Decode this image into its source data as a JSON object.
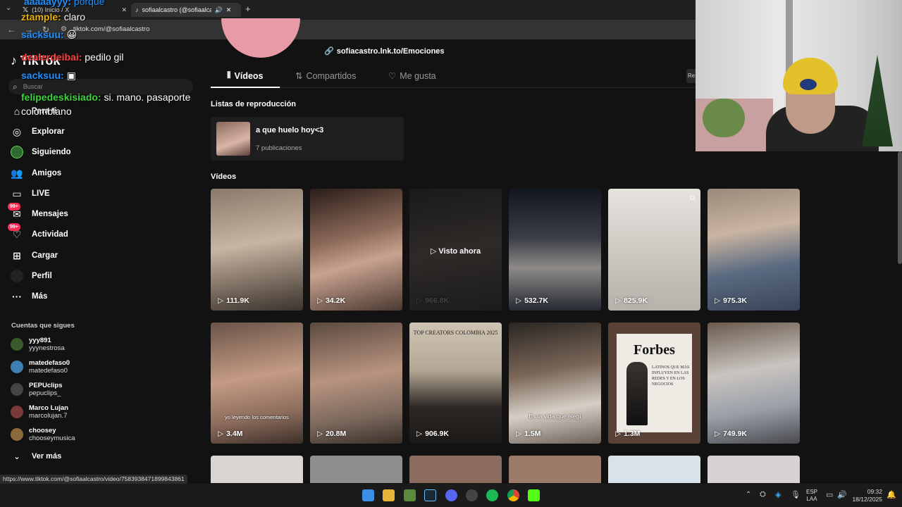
{
  "browser": {
    "tabs": [
      {
        "title": "(10) Inicio / X"
      },
      {
        "title": "sofiaalcastro (@sofiaalcastro"
      }
    ],
    "url": "tiktok.com/@sofiaalcastro",
    "status_url": "https://www.tiktok.com/@sofiaalcastro/video/7583938471899843861"
  },
  "sidebar": {
    "search_placeholder": "Buscar",
    "items": [
      {
        "label": "Para ti",
        "icon": "home-icon"
      },
      {
        "label": "Explorar",
        "icon": "compass-icon"
      },
      {
        "label": "Siguiendo",
        "icon": "following-icon"
      },
      {
        "label": "Amigos",
        "icon": "friends-icon"
      },
      {
        "label": "LIVE",
        "icon": "live-icon"
      },
      {
        "label": "Mensajes",
        "icon": "messages-icon",
        "badge": "99+"
      },
      {
        "label": "Actividad",
        "icon": "activity-icon",
        "badge": "99+"
      },
      {
        "label": "Cargar",
        "icon": "upload-icon"
      },
      {
        "label": "Perfil",
        "icon": "profile-icon"
      },
      {
        "label": "Más",
        "icon": "more-icon"
      }
    ],
    "following_title": "Cuentas que sigues",
    "following": [
      {
        "name": "yyy891",
        "handle": "yyynestrosa"
      },
      {
        "name": "matedefaso0",
        "handle": "matedefaso0"
      },
      {
        "name": "PEPUclips",
        "handle": "pepuclips_"
      },
      {
        "name": "Marco Lujan",
        "handle": "marcolujan.7"
      },
      {
        "name": "choosey",
        "handle": "chooseymusica"
      }
    ],
    "see_more": "Ver más"
  },
  "profile": {
    "link": "sofiacastro.lnk.to/Emociones",
    "tabs": [
      "Vídeos",
      "Compartidos",
      "Me gusta"
    ],
    "playlists_title": "Listas de reproducción",
    "playlist": {
      "name": "a que huelo hoy<3",
      "count": "7 publicaciones"
    },
    "videos_title": "Vídeos",
    "videos_row1": [
      {
        "views": "111.9K",
        "caption": ""
      },
      {
        "views": "34.2K",
        "caption": ""
      },
      {
        "views": "966.8K",
        "caption": "Visto ahora"
      },
      {
        "views": "532.7K",
        "caption": ""
      },
      {
        "views": "825.9K",
        "caption": ""
      },
      {
        "views": "975.3K",
        "caption": ""
      }
    ],
    "videos_row2": [
      {
        "views": "3.4M",
        "caption": "yo leyendo los comentarios"
      },
      {
        "views": "20.8M",
        "caption": ""
      },
      {
        "views": "906.9K",
        "caption": "TOP CREATORS COLOMBIA 2025"
      },
      {
        "views": "1.5M",
        "caption": "Es la vida que elegí"
      },
      {
        "views": "1.3M",
        "caption": "Forbes"
      },
      {
        "views": "749.9K",
        "caption": ""
      }
    ],
    "forbes_sub": "LATINOS QUE MÁS INFLUYEN EN LAS REDES Y EN LOS NEGOCIOS"
  },
  "chat": [
    {
      "user": "ztample:",
      "msg": "claro",
      "color": "#e8b000"
    },
    {
      "user": "sacksuu:",
      "msg": "",
      "color": "#1e90ff"
    },
    {
      "user": "dealerdeibai:",
      "msg": "pedilo gil",
      "color": "#ff4040"
    },
    {
      "user": "sacksuu:",
      "msg": "",
      "color": "#1e90ff"
    },
    {
      "user": "felipedeskisiado:",
      "msg": "si. mano. pasaporte colombiano",
      "color": "#3cd43c"
    }
  ],
  "taskbar": {
    "lang": "ESP",
    "lang2": "LAA",
    "time": "09:32",
    "date": "18/12/2025"
  },
  "colors": {
    "accent": "#fe2c55",
    "bg": "#121212"
  }
}
